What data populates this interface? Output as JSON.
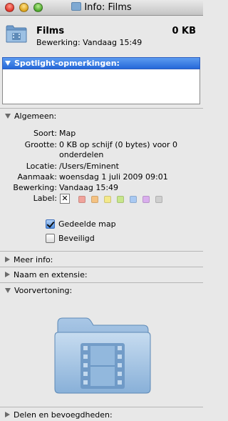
{
  "window": {
    "title": "Info: Films"
  },
  "header": {
    "name": "Films",
    "size": "0 KB",
    "modified": "Bewerking:  Vandaag 15:49"
  },
  "spotlight": {
    "label": "Spotlight-opmerkingen:",
    "value": ""
  },
  "general": {
    "label": "Algemeen:",
    "rows": [
      {
        "label": "Soort:",
        "value": "Map"
      },
      {
        "label": "Grootte:",
        "value": "0 KB op schijf (0 bytes) voor 0",
        "value2": "onderdelen"
      },
      {
        "label": "Locatie:",
        "value": "/Users/Eminent"
      },
      {
        "label": "Aanmaak:",
        "value": "woensdag 1 juli 2009 09:01"
      },
      {
        "label": "Bewerking:",
        "value": "Vandaag 15:49"
      },
      {
        "label": "Label:"
      }
    ],
    "label_clear": "✕",
    "label_colors": [
      "#f0a39b",
      "#f5c282",
      "#f3e88a",
      "#c7e68b",
      "#a9c9f2",
      "#d9aeed",
      "#cfcfcf"
    ],
    "shared_folder": {
      "label": "Gedeelde map",
      "checked": true
    },
    "locked": {
      "label": "Beveiligd",
      "checked": false
    }
  },
  "more_info": {
    "label": "Meer info:"
  },
  "name_ext": {
    "label": "Naam en extensie:"
  },
  "preview": {
    "label": "Voorvertoning:",
    "icon": "movies-folder-icon"
  },
  "sharing": {
    "label": "Delen en bevoegdheden:"
  },
  "colors": {
    "folder_blue": "#8fb2d6",
    "spotlight_blue": "#2f73e0"
  }
}
